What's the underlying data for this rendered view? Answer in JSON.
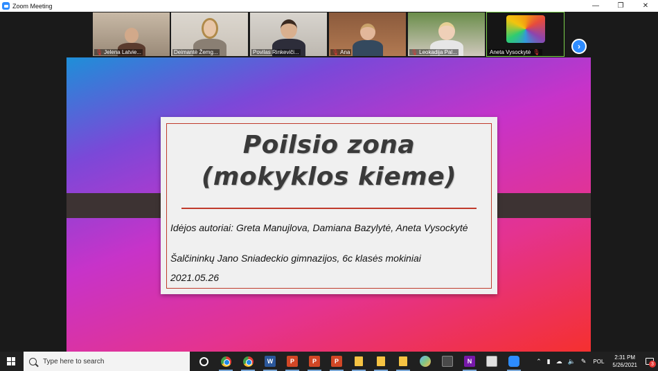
{
  "window": {
    "title": "Zoom Meeting",
    "controls": {
      "minimize": "—",
      "restore": "❐",
      "close": "✕"
    }
  },
  "gallery": {
    "participants": [
      {
        "name": "Jelena Latvie...",
        "muted": true
      },
      {
        "name": "Deimantė Žemg...",
        "muted": false
      },
      {
        "name": "Povilas Rinkeviči...",
        "muted": false
      },
      {
        "name": "Ana",
        "muted": true
      },
      {
        "name": "Leokadija Pal...",
        "muted": true
      },
      {
        "name": "Aneta Vysockytė",
        "muted": true,
        "active": true
      }
    ],
    "next_icon": "chevron-right-icon",
    "mute_glyph": "🎙"
  },
  "slide": {
    "title_line1": "Poilsio zona",
    "title_line2": "(mokyklos kieme)",
    "authors": "Idėjos autoriai: Greta Manujlova, Damiana Bazylytė, Aneta Vysockytė",
    "school": "Šalčininkų Jano Sniadeckio gimnazijos, 6c klasės mokiniai",
    "date": "2021.05.26",
    "accent_color": "#c0392b"
  },
  "taskbar": {
    "search_placeholder": "Type here to search",
    "apps": [
      {
        "name": "task-view",
        "open": false
      },
      {
        "name": "chrome",
        "open": true
      },
      {
        "name": "chrome",
        "open": true
      },
      {
        "name": "word",
        "label": "W",
        "color": "#2b579a",
        "open": true
      },
      {
        "name": "powerpoint",
        "label": "P",
        "color": "#d24726",
        "open": true
      },
      {
        "name": "powerpoint",
        "label": "P",
        "color": "#d24726",
        "open": true
      },
      {
        "name": "powerpoint",
        "label": "P",
        "color": "#d24726",
        "open": true
      },
      {
        "name": "file-explorer",
        "open": true
      },
      {
        "name": "file-explorer",
        "open": true
      },
      {
        "name": "file-explorer",
        "open": true
      },
      {
        "name": "paint",
        "open": false
      },
      {
        "name": "calculator",
        "open": false
      },
      {
        "name": "onenote",
        "label": "N",
        "color": "#7719aa",
        "open": true
      },
      {
        "name": "snipping-tool",
        "open": false
      },
      {
        "name": "zoom",
        "open": true
      }
    ],
    "tray": {
      "language": "POL",
      "time": "2:31 PM",
      "date": "5/26/2021",
      "notifications": "3"
    }
  }
}
